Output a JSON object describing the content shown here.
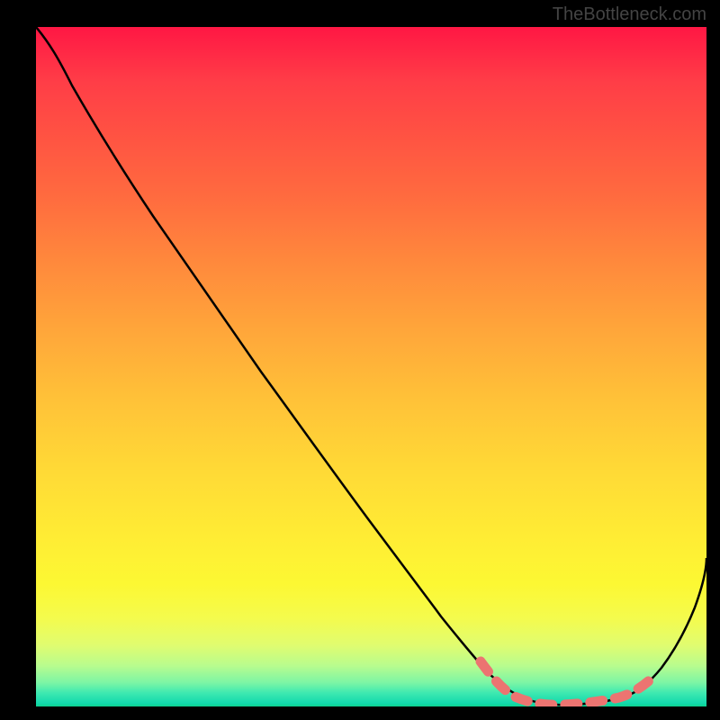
{
  "watermark": "TheBottleneck.com",
  "chart_data": {
    "type": "line",
    "title": "",
    "xlabel": "",
    "ylabel": "",
    "xlim": [
      0,
      100
    ],
    "ylim": [
      0,
      100
    ],
    "series": [
      {
        "name": "curve",
        "x": [
          0,
          3,
          6,
          10,
          15,
          20,
          25,
          30,
          35,
          40,
          45,
          50,
          55,
          58,
          62,
          66,
          70,
          74,
          78,
          82,
          85,
          88,
          91,
          94,
          97,
          100
        ],
        "y": [
          100,
          97,
          94,
          90,
          83,
          76,
          70,
          63,
          56,
          49,
          43,
          36,
          29,
          25,
          19,
          13,
          8,
          4,
          2,
          1,
          0.5,
          0.5,
          1.5,
          5,
          12,
          22
        ]
      }
    ],
    "markers": {
      "name": "highlighted-range",
      "x_range": [
        67,
        92
      ],
      "color": "#ec7471"
    }
  }
}
